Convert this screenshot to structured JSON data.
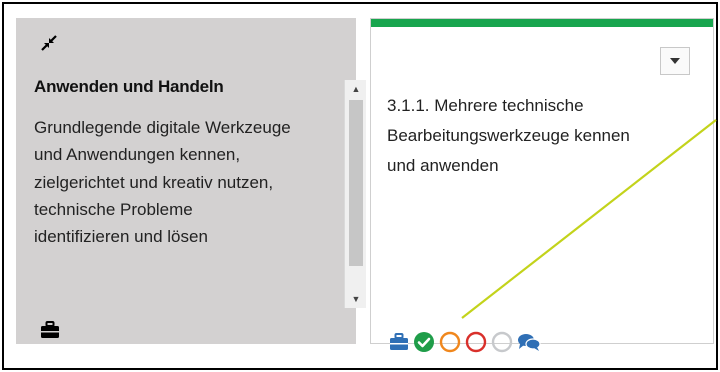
{
  "left_card": {
    "collapse_icon": "collapse-arrows-icon",
    "title": "Anwenden und Handeln",
    "description_lines": [
      "Grundlegende digitale Werkzeuge",
      "und Anwendungen kennen,",
      "zielgerichtet und kreativ nutzen,",
      "technische Probleme",
      "identifizieren und lösen"
    ],
    "footer_icon": "briefcase-icon"
  },
  "right_card": {
    "accent_color": "#18a54e",
    "dropdown_icon": "caret-down-icon",
    "text_lines": [
      "3.1.1. Mehrere technische",
      "Bearbeitungswerkzeuge kennen",
      "und anwenden"
    ],
    "status_icons": [
      {
        "name": "briefcase-icon",
        "color": "#2f6fb5"
      },
      {
        "name": "check-circle-icon",
        "color": "#1f9d49"
      },
      {
        "name": "circle-outline-icon",
        "color": "#f0871d"
      },
      {
        "name": "circle-outline-icon",
        "color": "#d9302b"
      },
      {
        "name": "circle-outline-icon",
        "color": "#c7c9cc"
      },
      {
        "name": "comments-icon",
        "color": "#2f6fb5"
      }
    ]
  },
  "annotation_color": "#c3d31b"
}
